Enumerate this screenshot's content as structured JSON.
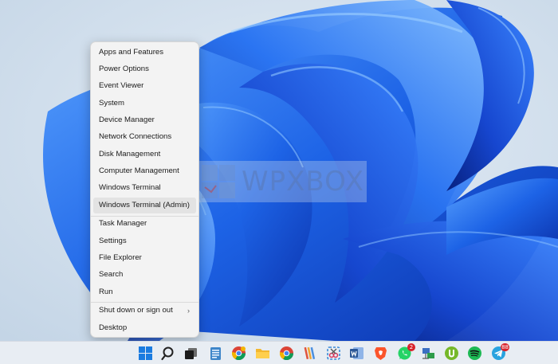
{
  "menu": {
    "items": [
      {
        "label": "Apps and Features"
      },
      {
        "label": "Power Options"
      },
      {
        "label": "Event Viewer"
      },
      {
        "label": "System"
      },
      {
        "label": "Device Manager"
      },
      {
        "label": "Network Connections"
      },
      {
        "label": "Disk Management"
      },
      {
        "label": "Computer Management"
      },
      {
        "label": "Windows Terminal"
      },
      {
        "label": "Windows Terminal (Admin)"
      },
      {
        "label": "Task Manager"
      },
      {
        "label": "Settings"
      },
      {
        "label": "File Explorer"
      },
      {
        "label": "Search"
      },
      {
        "label": "Run"
      },
      {
        "label": "Shut down or sign out",
        "chevron": "›"
      },
      {
        "label": "Desktop"
      }
    ]
  },
  "watermark": {
    "text": "WPXBOX"
  },
  "taskbar": {
    "icons": [
      {
        "name": "start-icon"
      },
      {
        "name": "search-icon"
      },
      {
        "name": "task-view-icon"
      },
      {
        "name": "notepad-icon"
      },
      {
        "name": "chrome-icon"
      },
      {
        "name": "file-explorer-icon"
      },
      {
        "name": "chrome-icon"
      },
      {
        "name": "pencil-app-icon"
      },
      {
        "name": "snipping-tool-icon"
      },
      {
        "name": "word-icon"
      },
      {
        "name": "brave-icon"
      },
      {
        "name": "whatsapp-icon",
        "badge": "2"
      },
      {
        "name": "network-app-icon"
      },
      {
        "name": "utorrent-icon"
      },
      {
        "name": "spotify-icon"
      },
      {
        "name": "telegram-icon",
        "badge": "88"
      }
    ]
  },
  "colors": {
    "menu_bg": "#f3f3f3",
    "menu_hover": "#e3e3e3",
    "wallpaper_blue": "#1a5ce0",
    "taskbar_bg": "#e8edf3"
  }
}
